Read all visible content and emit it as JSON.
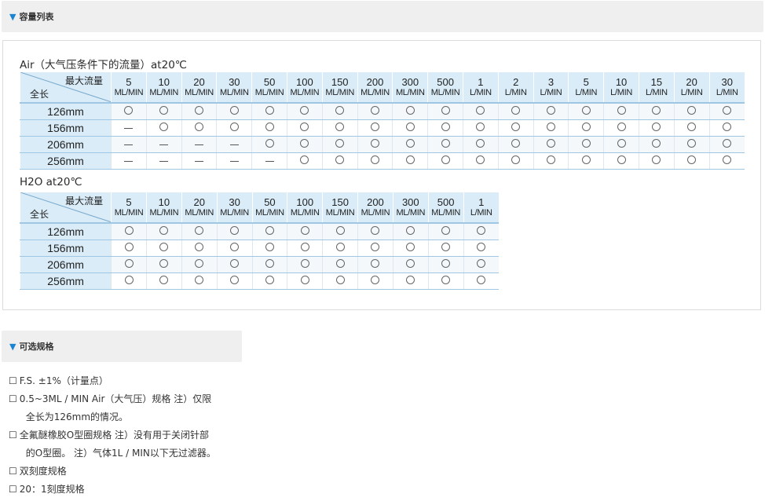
{
  "sections": {
    "capacity_title": "容量列表",
    "options_title": "可选规格"
  },
  "air_table": {
    "caption": "Air（大气压条件下的流量）at20℃",
    "corner_top": "最大流量",
    "corner_bottom": "全长",
    "columns": [
      {
        "v": "5",
        "u": "ML/MIN"
      },
      {
        "v": "10",
        "u": "ML/MIN"
      },
      {
        "v": "20",
        "u": "ML/MIN"
      },
      {
        "v": "30",
        "u": "ML/MIN"
      },
      {
        "v": "50",
        "u": "ML/MIN"
      },
      {
        "v": "100",
        "u": "ML/MIN"
      },
      {
        "v": "150",
        "u": "ML/MIN"
      },
      {
        "v": "200",
        "u": "ML/MIN"
      },
      {
        "v": "300",
        "u": "ML/MIN"
      },
      {
        "v": "500",
        "u": "ML/MIN"
      },
      {
        "v": "1",
        "u": "L/MIN"
      },
      {
        "v": "2",
        "u": "L/MIN"
      },
      {
        "v": "3",
        "u": "L/MIN"
      },
      {
        "v": "5",
        "u": "L/MIN"
      },
      {
        "v": "10",
        "u": "L/MIN"
      },
      {
        "v": "15",
        "u": "L/MIN"
      },
      {
        "v": "20",
        "u": "L/MIN"
      },
      {
        "v": "30",
        "u": "L/MIN"
      }
    ],
    "rows": [
      {
        "length": "126mm",
        "cells": [
          "○",
          "○",
          "○",
          "○",
          "○",
          "○",
          "○",
          "○",
          "○",
          "○",
          "○",
          "○",
          "○",
          "○",
          "○",
          "○",
          "○",
          "○"
        ]
      },
      {
        "length": "156mm",
        "cells": [
          "—",
          "○",
          "○",
          "○",
          "○",
          "○",
          "○",
          "○",
          "○",
          "○",
          "○",
          "○",
          "○",
          "○",
          "○",
          "○",
          "○",
          "○"
        ]
      },
      {
        "length": "206mm",
        "cells": [
          "—",
          "—",
          "—",
          "—",
          "○",
          "○",
          "○",
          "○",
          "○",
          "○",
          "○",
          "○",
          "○",
          "○",
          "○",
          "○",
          "○",
          "○"
        ]
      },
      {
        "length": "256mm",
        "cells": [
          "—",
          "—",
          "—",
          "—",
          "—",
          "○",
          "○",
          "○",
          "○",
          "○",
          "○",
          "○",
          "○",
          "○",
          "○",
          "○",
          "○",
          "○"
        ]
      }
    ]
  },
  "h2o_table": {
    "caption": "H2O at20℃",
    "corner_top": "最大流量",
    "corner_bottom": "全长",
    "columns": [
      {
        "v": "5",
        "u": "ML/MIN"
      },
      {
        "v": "10",
        "u": "ML/MIN"
      },
      {
        "v": "20",
        "u": "ML/MIN"
      },
      {
        "v": "30",
        "u": "ML/MIN"
      },
      {
        "v": "50",
        "u": "ML/MIN"
      },
      {
        "v": "100",
        "u": "ML/MIN"
      },
      {
        "v": "150",
        "u": "ML/MIN"
      },
      {
        "v": "200",
        "u": "ML/MIN"
      },
      {
        "v": "300",
        "u": "ML/MIN"
      },
      {
        "v": "500",
        "u": "ML/MIN"
      },
      {
        "v": "1",
        "u": "L/MIN"
      }
    ],
    "rows": [
      {
        "length": "126mm",
        "cells": [
          "○",
          "○",
          "○",
          "○",
          "○",
          "○",
          "○",
          "○",
          "○",
          "○",
          "○"
        ]
      },
      {
        "length": "156mm",
        "cells": [
          "○",
          "○",
          "○",
          "○",
          "○",
          "○",
          "○",
          "○",
          "○",
          "○",
          "○"
        ]
      },
      {
        "length": "206mm",
        "cells": [
          "○",
          "○",
          "○",
          "○",
          "○",
          "○",
          "○",
          "○",
          "○",
          "○",
          "○"
        ]
      },
      {
        "length": "256mm",
        "cells": [
          "○",
          "○",
          "○",
          "○",
          "○",
          "○",
          "○",
          "○",
          "○",
          "○",
          "○"
        ]
      }
    ]
  },
  "options": [
    {
      "box": "☐",
      "text": "F.S. ±1%（计量点）"
    },
    {
      "box": "☐",
      "text": "0.5~3ML / MIN Air（大气压）规格 注）仅限",
      "cont": "全长为126mm的情况。"
    },
    {
      "box": "☐",
      "text": "全氟醚橡胶O型圈规格 注）没有用于关闭针部",
      "cont": "的O型圈。 注）气体1L / MIN以下无过滤器。"
    },
    {
      "box": "☐",
      "text": "双刻度规格"
    },
    {
      "box": "☐",
      "text": "20：1刻度规格"
    }
  ]
}
